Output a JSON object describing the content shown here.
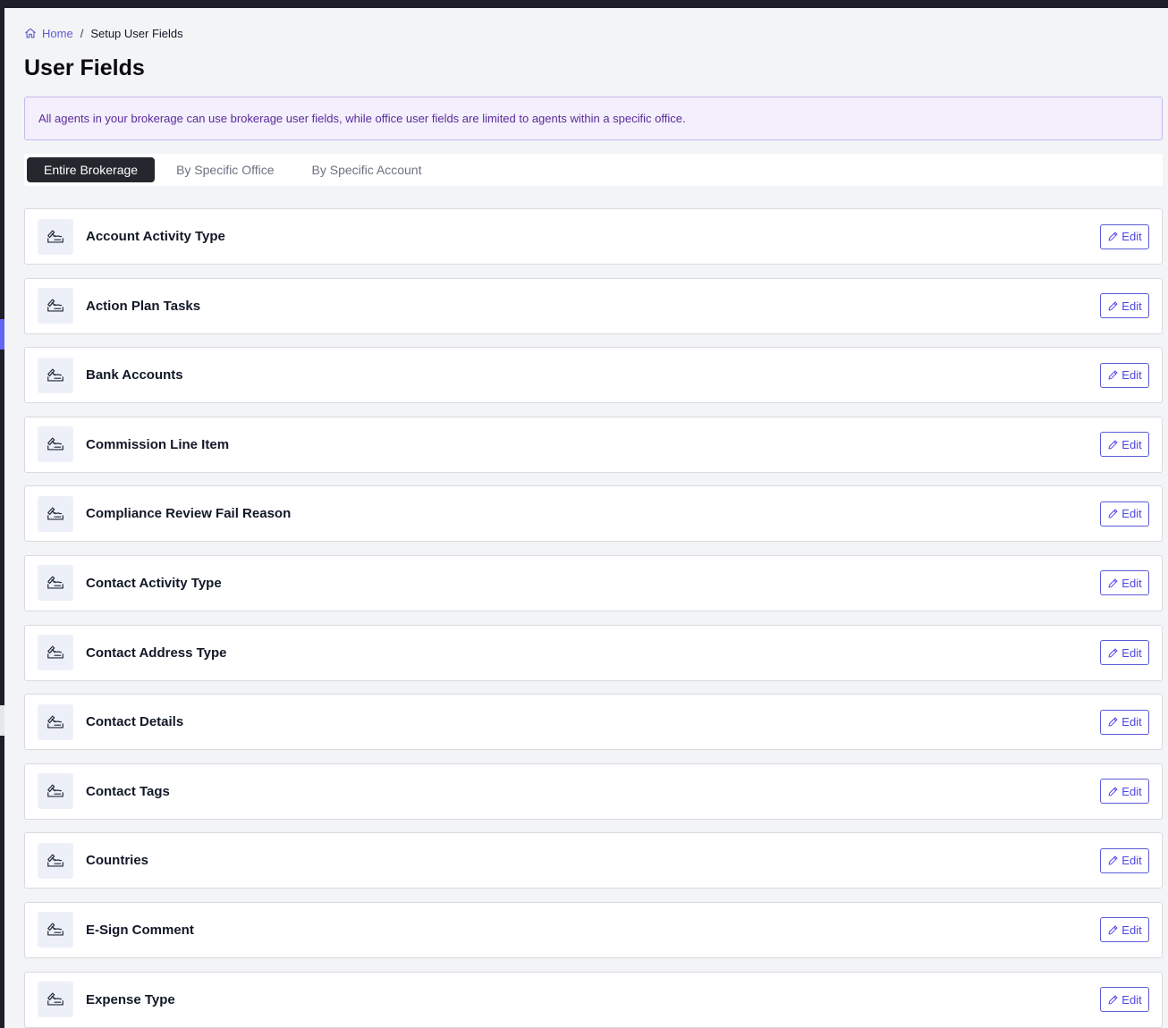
{
  "breadcrumb": {
    "home": "Home",
    "separator": "/",
    "current": "Setup User Fields"
  },
  "page": {
    "title": "User Fields",
    "info": "All agents in your brokerage can use brokerage user fields, while office user fields are limited to agents within a specific office."
  },
  "tabs": [
    {
      "label": "Entire Brokerage",
      "active": true
    },
    {
      "label": "By Specific Office",
      "active": false
    },
    {
      "label": "By Specific Account",
      "active": false
    }
  ],
  "edit_label": "Edit",
  "fields": [
    {
      "label": "Account Activity Type",
      "icon": "signature-icon"
    },
    {
      "label": "Action Plan Tasks",
      "icon": "signature-icon"
    },
    {
      "label": "Bank Accounts",
      "icon": "signature-icon"
    },
    {
      "label": "Commission Line Item",
      "icon": "signature-icon"
    },
    {
      "label": "Compliance Review Fail Reason",
      "icon": "signature-icon"
    },
    {
      "label": "Contact Activity Type",
      "icon": "signature-icon"
    },
    {
      "label": "Contact Address Type",
      "icon": "signature-icon"
    },
    {
      "label": "Contact Details",
      "icon": "signature-icon"
    },
    {
      "label": "Contact Tags",
      "icon": "signature-icon"
    },
    {
      "label": "Countries",
      "icon": "signature-icon"
    },
    {
      "label": "E-Sign Comment",
      "icon": "signature-icon"
    },
    {
      "label": "Expense Type",
      "icon": "signature-icon"
    }
  ],
  "colors": {
    "accent": "#5b5bd6",
    "active_tab": "#25272e",
    "banner_bg": "#f3effc",
    "banner_text": "#5b2a9a"
  }
}
